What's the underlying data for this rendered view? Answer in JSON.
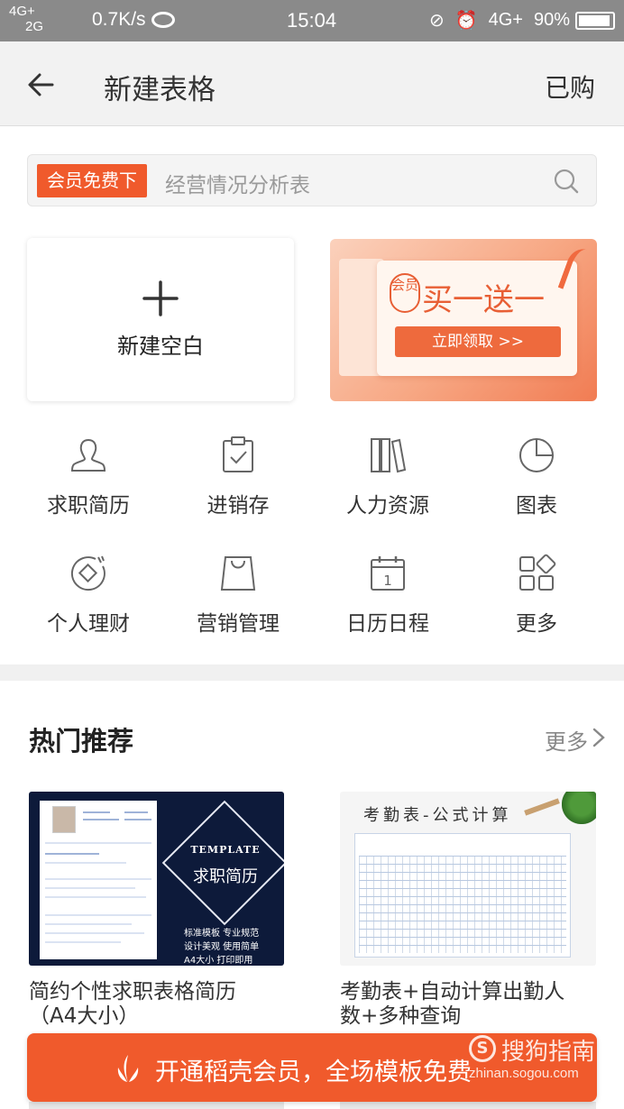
{
  "status_bar": {
    "network_top": "4G+",
    "network_bottom": "2G",
    "speed": "0.7K/s",
    "time": "15:04",
    "network_right": "4G+",
    "battery": "90%"
  },
  "navbar": {
    "title": "新建表格",
    "right_action": "已购"
  },
  "search": {
    "tag": "会员免费下",
    "placeholder": "经营情况分析表"
  },
  "blank_card": {
    "label": "新建空白"
  },
  "promo": {
    "badge": "会员",
    "title": "买一送一",
    "button": "立即领取 >>"
  },
  "categories": [
    {
      "label": "求职简历",
      "icon": "person-icon"
    },
    {
      "label": "进销存",
      "icon": "clipboard-check-icon"
    },
    {
      "label": "人力资源",
      "icon": "books-icon"
    },
    {
      "label": "图表",
      "icon": "pie-chart-icon"
    },
    {
      "label": "个人理财",
      "icon": "coin-icon"
    },
    {
      "label": "营销管理",
      "icon": "shopping-bag-icon"
    },
    {
      "label": "日历日程",
      "icon": "calendar-icon"
    },
    {
      "label": "更多",
      "icon": "grid-more-icon"
    }
  ],
  "recommend": {
    "title": "热门推荐",
    "more": "更多",
    "templates": [
      {
        "name_line1": "简约个性求职表格简历",
        "name_line2": "（A4大小）",
        "thumb_badge": "TEMPLATE",
        "thumb_title": "求职简历",
        "thumb_features": [
          "标准模板 专业规范",
          "设计美观 使用简单",
          "A4大小 打印即用"
        ]
      },
      {
        "name_line1": "考勤表+自动计算出勤人",
        "name_line2": "数+多种查询",
        "thumb_title": "考勤表-公式计算"
      }
    ]
  },
  "bottom_banner": {
    "text": "开通稻壳会员，全场模板免费"
  },
  "watermark": {
    "name": "搜狗指南",
    "url": "zhinan.sogou.com"
  },
  "colors": {
    "accent": "#f05a2c",
    "status_bar": "#8a8a8a",
    "nav_bg": "#f2f2f2",
    "icon_stroke": "#666666"
  }
}
